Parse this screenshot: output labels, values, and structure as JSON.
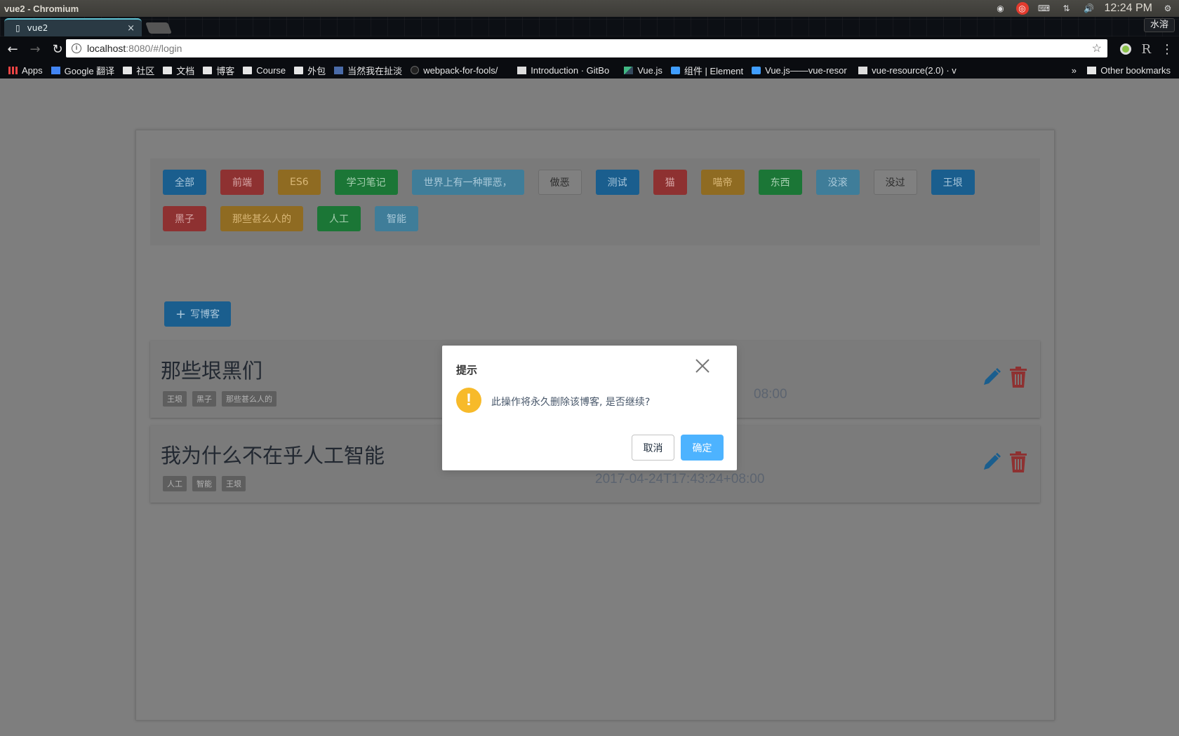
{
  "os": {
    "window_title": "vue2 - Chromium",
    "clock": "12:24 PM"
  },
  "browser": {
    "tab_title": "vue2",
    "tab_close": "×",
    "profile_name": "水溶",
    "url_host": "localhost",
    "url_path": ":8080/#/login",
    "bookmarks": [
      {
        "label": "Apps",
        "icon": "apps-grid-icon"
      },
      {
        "label": "Google 翻译",
        "icon": "google-translate-icon"
      },
      {
        "label": "社区",
        "icon": "folder-icon"
      },
      {
        "label": "文档",
        "icon": "folder-icon"
      },
      {
        "label": "博客",
        "icon": "folder-icon"
      },
      {
        "label": "Course",
        "icon": "folder-icon"
      },
      {
        "label": "外包",
        "icon": "folder-icon"
      },
      {
        "label": "当然我在扯淡",
        "icon": "yinxiang-icon"
      },
      {
        "label": "webpack-for-fools/",
        "icon": "github-icon"
      },
      {
        "label": "Introduction · GitBo",
        "icon": "gitbook-icon"
      },
      {
        "label": "Vue.js",
        "icon": "vue-icon"
      },
      {
        "label": "组件 | Element",
        "icon": "element-icon"
      },
      {
        "label": "Vue.js——vue-resor",
        "icon": "blog-icon"
      },
      {
        "label": "vue-resource(2.0) · v",
        "icon": "gitbook-icon"
      }
    ],
    "bookmarks_overflow": "»",
    "other_bookmarks": "Other bookmarks"
  },
  "tags": [
    {
      "label": "全部",
      "color": "blue"
    },
    {
      "label": "前端",
      "color": "red"
    },
    {
      "label": "ES6",
      "color": "orange"
    },
    {
      "label": "学习笔记",
      "color": "green"
    },
    {
      "label": "世界上有一种罪恶，",
      "color": "cyan"
    },
    {
      "label": "做恶",
      "color": "white"
    },
    {
      "label": "测试",
      "color": "blue"
    },
    {
      "label": "猫",
      "color": "red"
    },
    {
      "label": "喵帝",
      "color": "orange"
    },
    {
      "label": "东西",
      "color": "green"
    },
    {
      "label": "没滚",
      "color": "cyan"
    },
    {
      "label": "没过",
      "color": "white"
    },
    {
      "label": "王垠",
      "color": "blue"
    },
    {
      "label": "黑子",
      "color": "red"
    },
    {
      "label": "那些甚么人的",
      "color": "orange"
    },
    {
      "label": "人工",
      "color": "green"
    },
    {
      "label": "智能",
      "color": "cyan"
    }
  ],
  "write_button": "写博客",
  "blogs": [
    {
      "title": "那些垠黑们",
      "tags": [
        "王垠",
        "黑子",
        "那些甚么人的"
      ],
      "date": "08:00"
    },
    {
      "title": "我为什么不在乎人工智能",
      "tags": [
        "人工",
        "智能",
        "王垠"
      ],
      "date": "2017-04-24T17:43:24+08:00"
    }
  ],
  "dialog": {
    "title": "提示",
    "message": "此操作将永久删除该博客, 是否继续?",
    "icon_glyph": "!",
    "cancel": "取消",
    "confirm": "确定"
  },
  "colors": {
    "accent": "#4db3ff",
    "warning": "#f7ba2a"
  }
}
